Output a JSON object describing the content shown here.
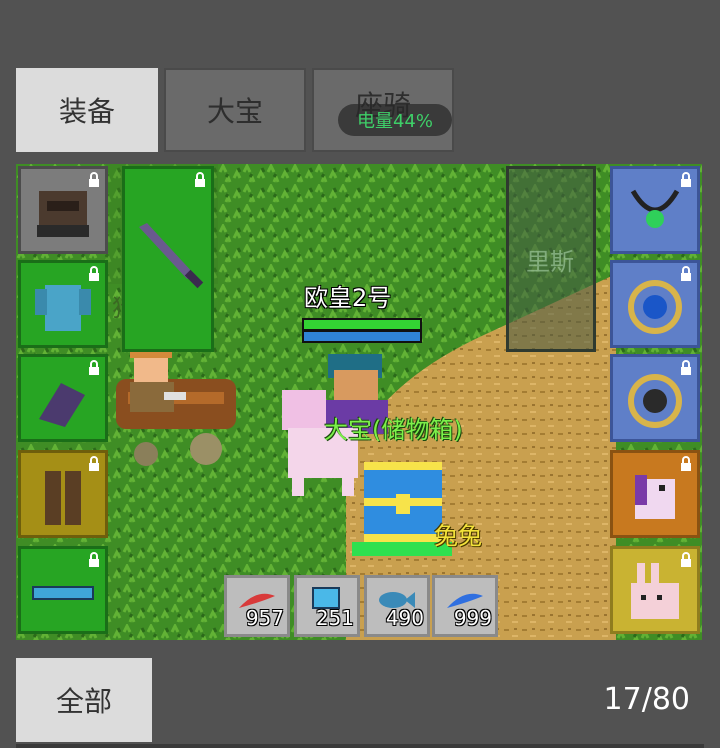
{
  "tabs": [
    {
      "label": "装备",
      "active": true
    },
    {
      "label": "大宝",
      "active": false
    },
    {
      "label": "座骑",
      "active": false
    }
  ],
  "battery_label": "电量44%",
  "scene": {
    "player_name": "欧皇2号",
    "pet_label": "大宝(储物箱)",
    "mount_label": "兔兔",
    "npc_partial_label": "猎人",
    "ghost_text": "里斯"
  },
  "left_slots": [
    {
      "icon": "helmet-icon",
      "color": "grey"
    },
    {
      "icon": "armor-icon",
      "color": "green"
    },
    {
      "icon": "gloves-icon",
      "color": "green"
    },
    {
      "icon": "pants-icon",
      "color": "olive"
    },
    {
      "icon": "belt-icon",
      "color": "green"
    }
  ],
  "weapon_slot": {
    "icon": "sword-icon",
    "color": "green"
  },
  "right_slots": [
    {
      "icon": "necklace-icon",
      "color": "blue"
    },
    {
      "icon": "ring-blue-icon",
      "color": "blue"
    },
    {
      "icon": "ring-dark-icon",
      "color": "blue"
    },
    {
      "icon": "unicorn-mount-icon",
      "color": "orange"
    },
    {
      "icon": "rabbit-pet-icon",
      "color": "gold"
    }
  ],
  "inventory": [
    {
      "icon": "red-feather-icon",
      "count": "957"
    },
    {
      "icon": "blue-crystal-icon",
      "count": "251"
    },
    {
      "icon": "fish-icon",
      "count": "490"
    },
    {
      "icon": "blue-feather-icon",
      "count": "999"
    }
  ],
  "bottom": {
    "all_button": "全部",
    "counter": "17/80"
  }
}
